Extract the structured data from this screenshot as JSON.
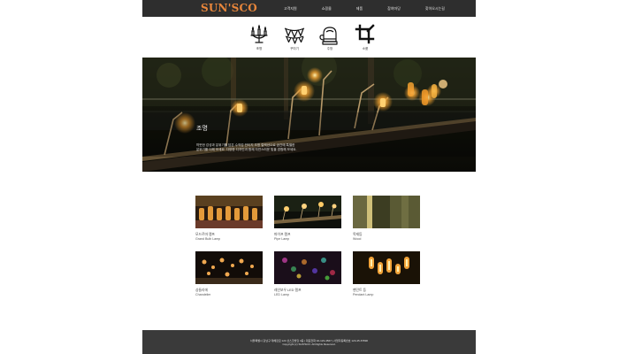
{
  "header": {
    "logo": "SUN'SCO",
    "nav": [
      "고객지원",
      "쇼핑몰",
      "제품",
      "참여마당",
      "찾아오시는길"
    ]
  },
  "categories": [
    {
      "icon": "candelabra-icon",
      "label": "조명"
    },
    {
      "icon": "bunting-flags-icon",
      "label": "꾸미기"
    },
    {
      "icon": "oven-mitt-icon",
      "label": "주방"
    },
    {
      "icon": "crop-icon",
      "label": "소품"
    }
  ],
  "hero": {
    "title": "조명",
    "description": "따뜻한 감성과 분위기를 담은 수작업 빈티지 조명 컬렉션으로 공간에 특별한 분위기를 더해 보세요. 다양한 디자인과 함께 자연스러운 빛을 경험해 보세요."
  },
  "products": [
    {
      "name": "모드르마 램프",
      "sub": "Grand Bulb Lamp"
    },
    {
      "name": "파이프 램프",
      "sub": "Pipe Lamp"
    },
    {
      "name": "목재등",
      "sub": "Wood"
    },
    {
      "name": "샹들리에",
      "sub": "Chandelier"
    },
    {
      "name": "레인보우 LED 램프",
      "sub": "LED Lamp"
    },
    {
      "name": "팬던트 등",
      "sub": "Pendant Lamp"
    }
  ],
  "footer": {
    "line1": "서울특별시 강남구 테헤란로 123 선스코빌딩 3층 | 대표전화 02-123-4567 | 사업자등록번호 123-45-67890",
    "line2": "Copyright (c) SUN'SCO. All Rights Reserved."
  },
  "colors": {
    "accent": "#e8863b",
    "topbar": "#2e2e2e",
    "footer": "#3a3a3a"
  }
}
